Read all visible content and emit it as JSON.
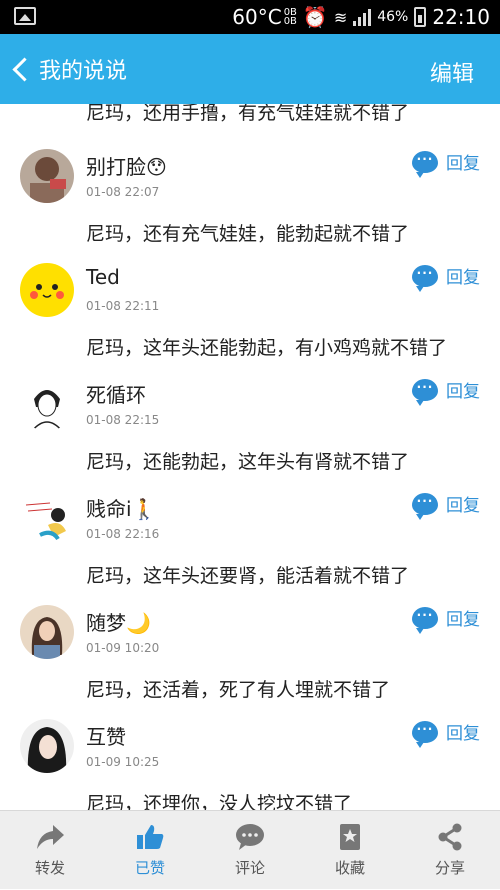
{
  "status_bar": {
    "temperature": "60°C",
    "net_up": "0B",
    "net_down": "0B",
    "battery_pct": "46%",
    "time": "22:10"
  },
  "header": {
    "back_label": "我的说说",
    "edit_label": "编辑"
  },
  "partial_text": "尼玛，还用手撸，有充气娃娃就不错了",
  "reply_label": "回复",
  "comments": [
    {
      "name": "别打脸😯",
      "time": "01-08 22:07",
      "text": "尼玛，还有充气娃娃，能勃起就不错了"
    },
    {
      "name": "Ted",
      "time": "01-08 22:11",
      "text": "尼玛，这年头还能勃起，有小鸡鸡就不错了"
    },
    {
      "name": "死循环",
      "time": "01-08 22:15",
      "text": "尼玛，还能勃起，这年头有肾就不错了"
    },
    {
      "name": "贱命i🚶",
      "time": "01-08 22:16",
      "text": "尼玛，这年头还要肾，能活着就不错了"
    },
    {
      "name": "随梦🌙",
      "time": "01-09 10:20",
      "text": "尼玛，还活着，死了有人埋就不错了"
    },
    {
      "name": "互赞",
      "time": "01-09 10:25",
      "text": "尼玛，还埋你，没人挖坟不错了"
    }
  ],
  "bottom_bar": {
    "forward": "转发",
    "liked": "已赞",
    "comment": "评论",
    "favorite": "收藏",
    "share": "分享"
  },
  "colors": {
    "header_bg": "#2eaee8",
    "accent": "#2e8fd6"
  }
}
